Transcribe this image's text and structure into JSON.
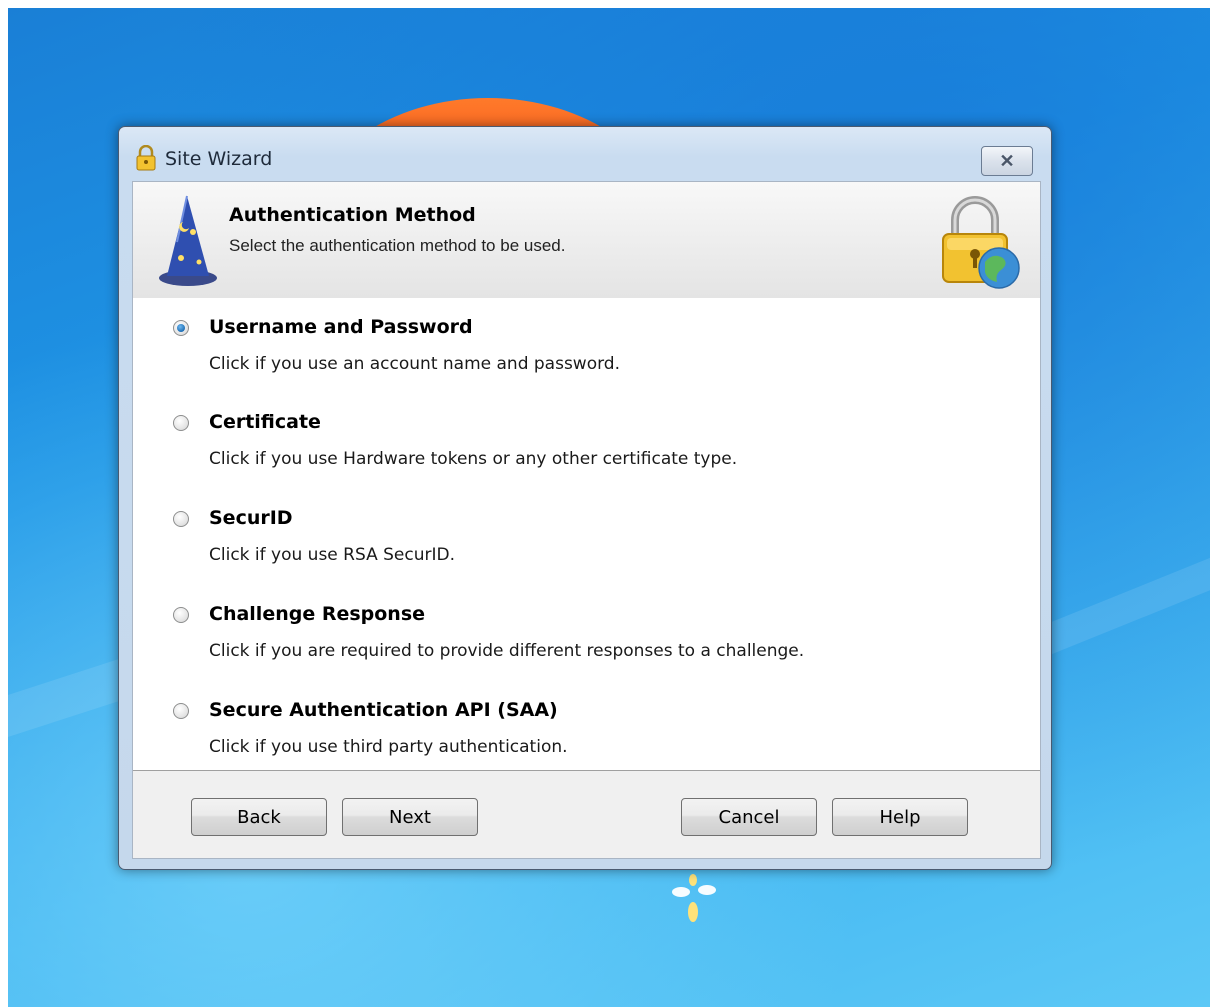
{
  "window": {
    "title": "Site Wizard",
    "close_icon": "close-icon"
  },
  "header": {
    "title": "Authentication Method",
    "subtitle": "Select the authentication method to be used.",
    "left_icon": "wizard-hat-icon",
    "right_icon": "lock-globe-icon"
  },
  "options": [
    {
      "label": "Username and Password",
      "description": "Click if you use an account name and password.",
      "selected": true
    },
    {
      "label": "Certificate",
      "description": "Click if you use Hardware tokens or any other certificate type.",
      "selected": false
    },
    {
      "label": "SecurID",
      "description": "Click if you use RSA SecurID.",
      "selected": false
    },
    {
      "label": "Challenge Response",
      "description": "Click if you are required to provide different responses to a challenge.",
      "selected": false
    },
    {
      "label": "Secure Authentication API (SAA)",
      "description": "Click if you use third party authentication.",
      "selected": false
    }
  ],
  "buttons": {
    "back": "Back",
    "next": "Next",
    "cancel": "Cancel",
    "help": "Help"
  }
}
